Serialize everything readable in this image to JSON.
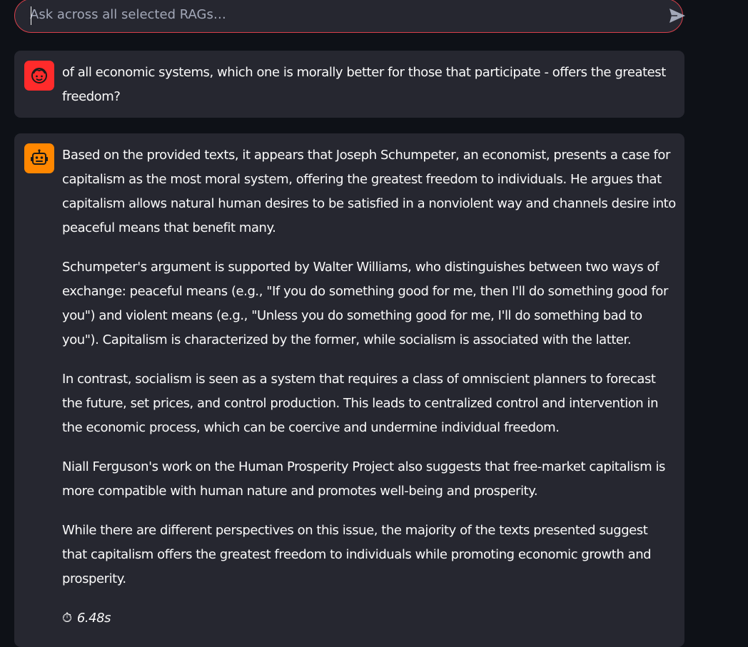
{
  "chat_input": {
    "placeholder": "Ask across all selected RAGs…",
    "value": "",
    "send_icon": "send-icon"
  },
  "messages": [
    {
      "role": "user",
      "avatar_icon": "user-face-icon",
      "avatar_color": "#ff2b2b",
      "text": "of all economic systems, which one is morally better for those that participate - offers the greatest freedom?"
    },
    {
      "role": "assistant",
      "avatar_icon": "robot-icon",
      "avatar_color": "#ff8700",
      "paragraphs": [
        "Based on the provided texts, it appears that Joseph Schumpeter, an economist, presents a case for capitalism as the most moral system, offering the greatest freedom to individuals. He argues that capitalism allows natural human desires to be satisfied in a nonviolent way and channels desire into peaceful means that benefit many.",
        "Schumpeter's argument is supported by Walter Williams, who distinguishes between two ways of exchange: peaceful means (e.g., \"If you do something good for me, then I'll do something good for you\") and violent means (e.g., \"Unless you do something good for me, I'll do something bad to you\"). Capitalism is characterized by the former, while socialism is associated with the latter.",
        "In contrast, socialism is seen as a system that requires a class of omniscient planners to forecast the future, set prices, and control production. This leads to centralized control and intervention in the economic process, which can be coercive and undermine individual freedom.",
        "Niall Ferguson's work on the Human Prosperity Project also suggests that free-market capitalism is more compatible with human nature and promotes well-being and prosperity.",
        "While there are different perspectives on this issue, the majority of the texts presented suggest that capitalism offers the greatest freedom to individuals while promoting economic growth and prosperity."
      ],
      "elapsed_icon": "⏱",
      "elapsed": "6.48s"
    }
  ]
}
